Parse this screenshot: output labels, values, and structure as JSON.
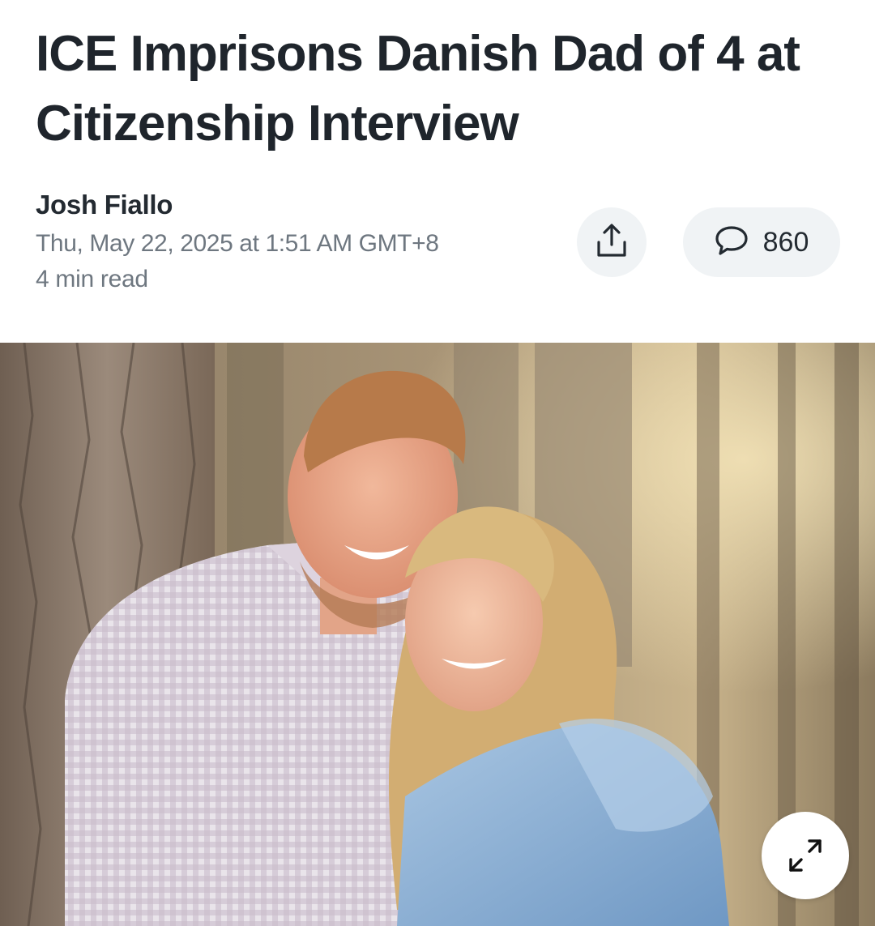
{
  "article": {
    "headline": "ICE Imprisons Danish Dad of 4 at Citizenship Interview",
    "author": "Josh Fiallo",
    "dateline": "Thu, May 22, 2025 at 1:51 AM GMT+8",
    "read_time": "4 min read"
  },
  "actions": {
    "share_icon": "share-icon",
    "comment_icon": "comment-icon",
    "comment_count": "860",
    "expand_icon": "expand-icon"
  },
  "colors": {
    "text_primary": "#1f252c",
    "text_secondary": "#6e7780",
    "button_bg": "#f0f3f5"
  }
}
